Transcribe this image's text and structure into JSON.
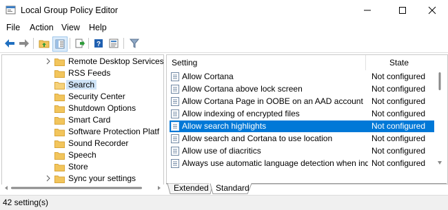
{
  "window": {
    "title": "Local Group Policy Editor"
  },
  "menu": [
    "File",
    "Action",
    "View",
    "Help"
  ],
  "toolbar_icons": [
    "back-icon",
    "forward-icon",
    "up-folder-icon",
    "show-hide-tree-icon",
    "export-list-icon",
    "help-icon",
    "properties-icon",
    "filter-icon"
  ],
  "tree": {
    "items": [
      {
        "label": "Remote Desktop Services",
        "expandable": true
      },
      {
        "label": "RSS Feeds",
        "expandable": false
      },
      {
        "label": "Search",
        "expandable": false,
        "selected": true
      },
      {
        "label": "Security Center",
        "expandable": false
      },
      {
        "label": "Shutdown Options",
        "expandable": false
      },
      {
        "label": "Smart Card",
        "expandable": false
      },
      {
        "label": "Software Protection Platf",
        "expandable": false
      },
      {
        "label": "Sound Recorder",
        "expandable": false
      },
      {
        "label": "Speech",
        "expandable": false
      },
      {
        "label": "Store",
        "expandable": false
      },
      {
        "label": "Sync your settings",
        "expandable": true
      }
    ]
  },
  "list": {
    "headers": {
      "setting": "Setting",
      "state": "State"
    },
    "rows": [
      {
        "setting": "Allow Cortana",
        "state": "Not configured"
      },
      {
        "setting": "Allow Cortana above lock screen",
        "state": "Not configured"
      },
      {
        "setting": "Allow Cortana Page in OOBE on an AAD account",
        "state": "Not configured"
      },
      {
        "setting": "Allow indexing of encrypted files",
        "state": "Not configured"
      },
      {
        "setting": "Allow search highlights",
        "state": "Not configured",
        "selected": true
      },
      {
        "setting": "Allow search and Cortana to use location",
        "state": "Not configured"
      },
      {
        "setting": "Allow use of diacritics",
        "state": "Not configured"
      },
      {
        "setting": "Always use automatic language detection when ind...",
        "state": "Not configured"
      }
    ]
  },
  "tabs": [
    "Extended",
    "Standard"
  ],
  "active_tab": "Standard",
  "status": "42 setting(s)",
  "colors": {
    "selection": "#0078d7",
    "tree_selection": "#cfe4f7",
    "folder": "#f2c55c"
  }
}
